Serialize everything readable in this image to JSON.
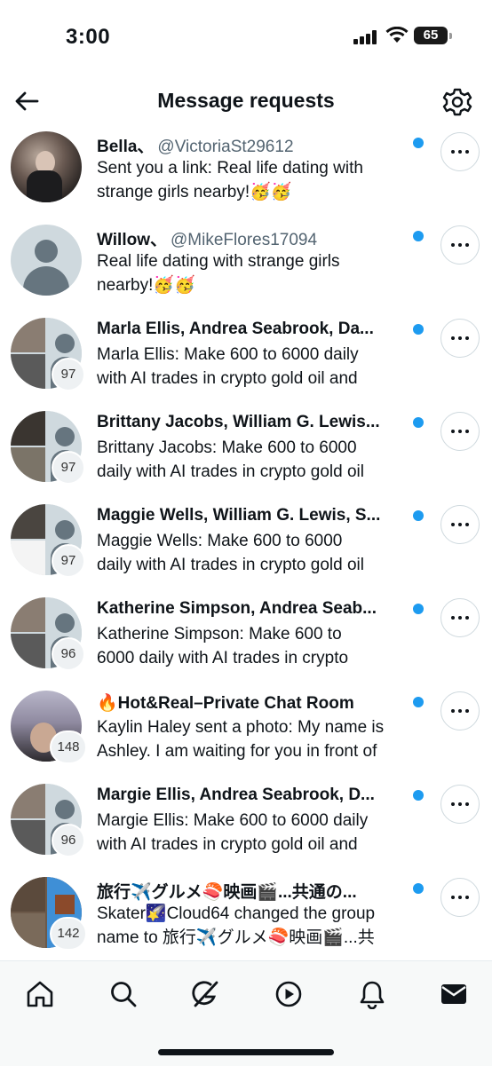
{
  "status": {
    "time": "3:00",
    "battery": "65"
  },
  "header": {
    "title": "Message requests"
  },
  "conversations": [
    {
      "name": "Bella、",
      "handle": "@VictoriaSt29612",
      "line1": "Sent you a link: Real life dating with",
      "line2": "strange girls nearby!🥳🥳",
      "badge": ""
    },
    {
      "name": "Willow、",
      "handle": "@MikeFlores17094",
      "line1": "Real life dating with strange girls",
      "line2": "nearby!🥳🥳",
      "badge": ""
    },
    {
      "name": "Marla Ellis, Andrea Seabrook, Da...",
      "handle": "",
      "line1": "Marla Ellis: Make 600 to 6000 daily",
      "line2": "with AI trades in crypto gold oil and",
      "badge": "97"
    },
    {
      "name": "Brittany Jacobs, William G. Lewis...",
      "handle": "",
      "line1": "Brittany Jacobs: Make 600 to 6000",
      "line2": "daily with AI trades in crypto gold oil",
      "badge": "97"
    },
    {
      "name": "Maggie Wells, William G. Lewis, S...",
      "handle": "",
      "line1": "Maggie Wells: Make 600 to 6000",
      "line2": "daily with AI trades in crypto gold oil",
      "badge": "97"
    },
    {
      "name": "Katherine Simpson, Andrea Seab...",
      "handle": "",
      "line1": "Katherine Simpson: Make 600 to",
      "line2": "6000 daily with AI trades in crypto",
      "badge": "96"
    },
    {
      "name": "🔥Hot&Real–Private Chat Room",
      "handle": "",
      "line1": "Kaylin Haley sent a photo: My name is",
      "line2": "Ashley. I am waiting for you in front of",
      "badge": "148"
    },
    {
      "name": "Margie Ellis, Andrea Seabrook, D...",
      "handle": "",
      "line1": "Margie Ellis: Make 600 to 6000 daily",
      "line2": "with AI trades in crypto gold oil and",
      "badge": "96"
    },
    {
      "name": "旅行✈️グルメ🍣映画🎬...共通の...",
      "handle": "",
      "line1": "Skater🌠Cloud64 changed the group",
      "line2": "name to 旅行✈️グルメ🍣映画🎬...共",
      "badge": "142"
    }
  ],
  "tabs": [
    "home-icon",
    "search-icon",
    "grok-icon",
    "video-icon",
    "notifications-icon",
    "messages-icon"
  ]
}
